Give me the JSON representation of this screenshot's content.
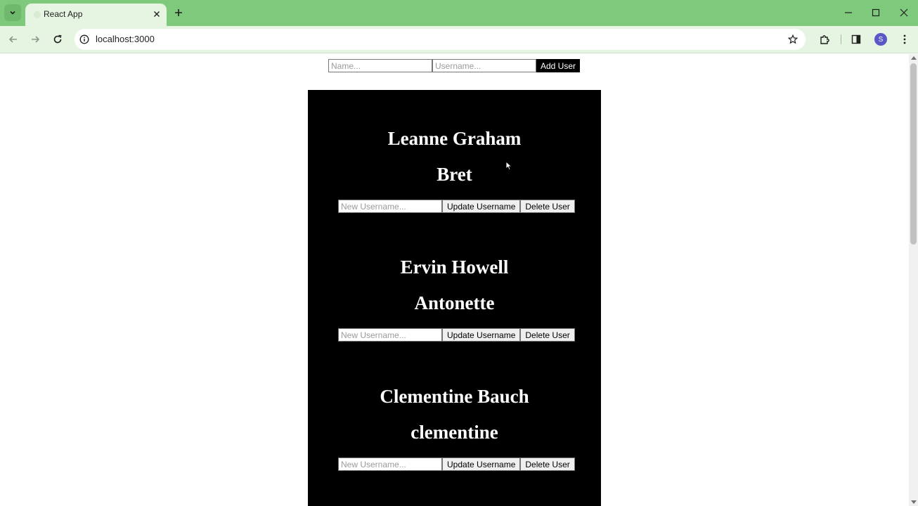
{
  "browser": {
    "tab_title": "React App",
    "url": "localhost:3000",
    "profile_initial": "S"
  },
  "add_form": {
    "name_placeholder": "Name...",
    "username_placeholder": "Username...",
    "add_button": "Add User"
  },
  "users": [
    {
      "name": "Leanne Graham",
      "username": "Bret"
    },
    {
      "name": "Ervin Howell",
      "username": "Antonette"
    },
    {
      "name": "Clementine Bauch",
      "username": "clementine"
    }
  ],
  "card_controls": {
    "new_username_placeholder": "New Username...",
    "update_button": "Update Username",
    "delete_button": "Delete User"
  },
  "colors": {
    "tabbar": "#7fc97c",
    "toolbar": "#e6f4e2",
    "list_background": "#000000"
  }
}
